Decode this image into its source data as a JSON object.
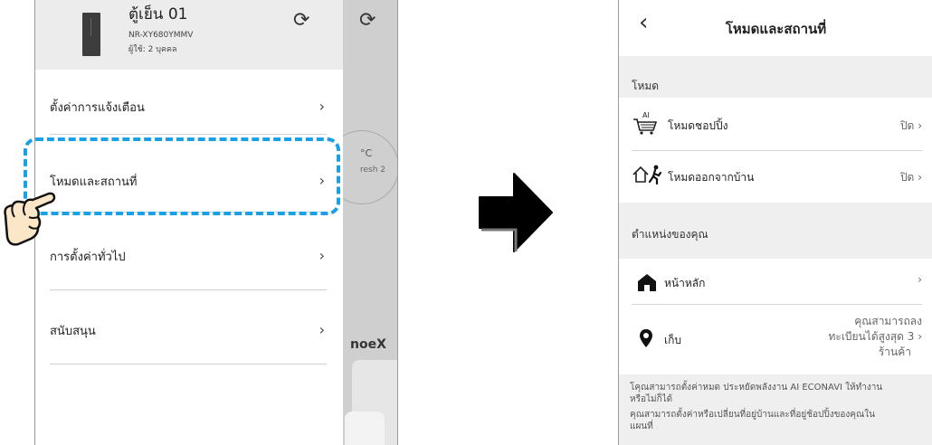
{
  "left": {
    "device_name": "ตู้เย็น 01",
    "device_model": "NR-XY680YMMV",
    "device_users": "ผู้ใช้: 2 บุคคล",
    "menu": [
      {
        "label": "ตั้งค่าการแจ้งเตือน"
      },
      {
        "label": "โหมดและสถานที่"
      },
      {
        "label": "การตั้งค่าทั่วไป"
      },
      {
        "label": "สนับสนุน"
      }
    ],
    "background": {
      "temp_unit": "°C",
      "mode_text": "resh 2",
      "brand": "noeX"
    }
  },
  "right": {
    "title": "โหมดและสถานที่",
    "section_mode": "โหมด",
    "shopping_mode": {
      "label": "โหมดชอปปิ้ง",
      "value": "ปิด",
      "badge": "AI"
    },
    "away_mode": {
      "label": "โหมดออกจากบ้าน",
      "value": "ปิด"
    },
    "section_location": "ตำแหน่งของคุณ",
    "home": {
      "label": "หน้าหลัก"
    },
    "store": {
      "label": "เก็บ",
      "value_line1": "คุณสามารถลง",
      "value_line2": "ทะเบียนได้สูงสุด 3",
      "value_line3": "ร้านค้า"
    },
    "footer": {
      "line1": "โคุณสามารถตั้งค่าหมด ประหยัดพลังงาน AI ECONAVI ให้ทำงาน",
      "line2": "หรือไม่ก็ได้",
      "line3": "คุณสามารถตั้งค่าหรือเปลี่ยนที่อยู่บ้านและที่อยู่ช้อปปิ้งของคุณใน",
      "line4": "แผนที่"
    }
  },
  "icons": {
    "chevron": "›",
    "back": "‹",
    "refresh": "⟳",
    "colors": {
      "highlight": "#1aa0e6",
      "hand_fill": "#fbe6c8"
    }
  }
}
